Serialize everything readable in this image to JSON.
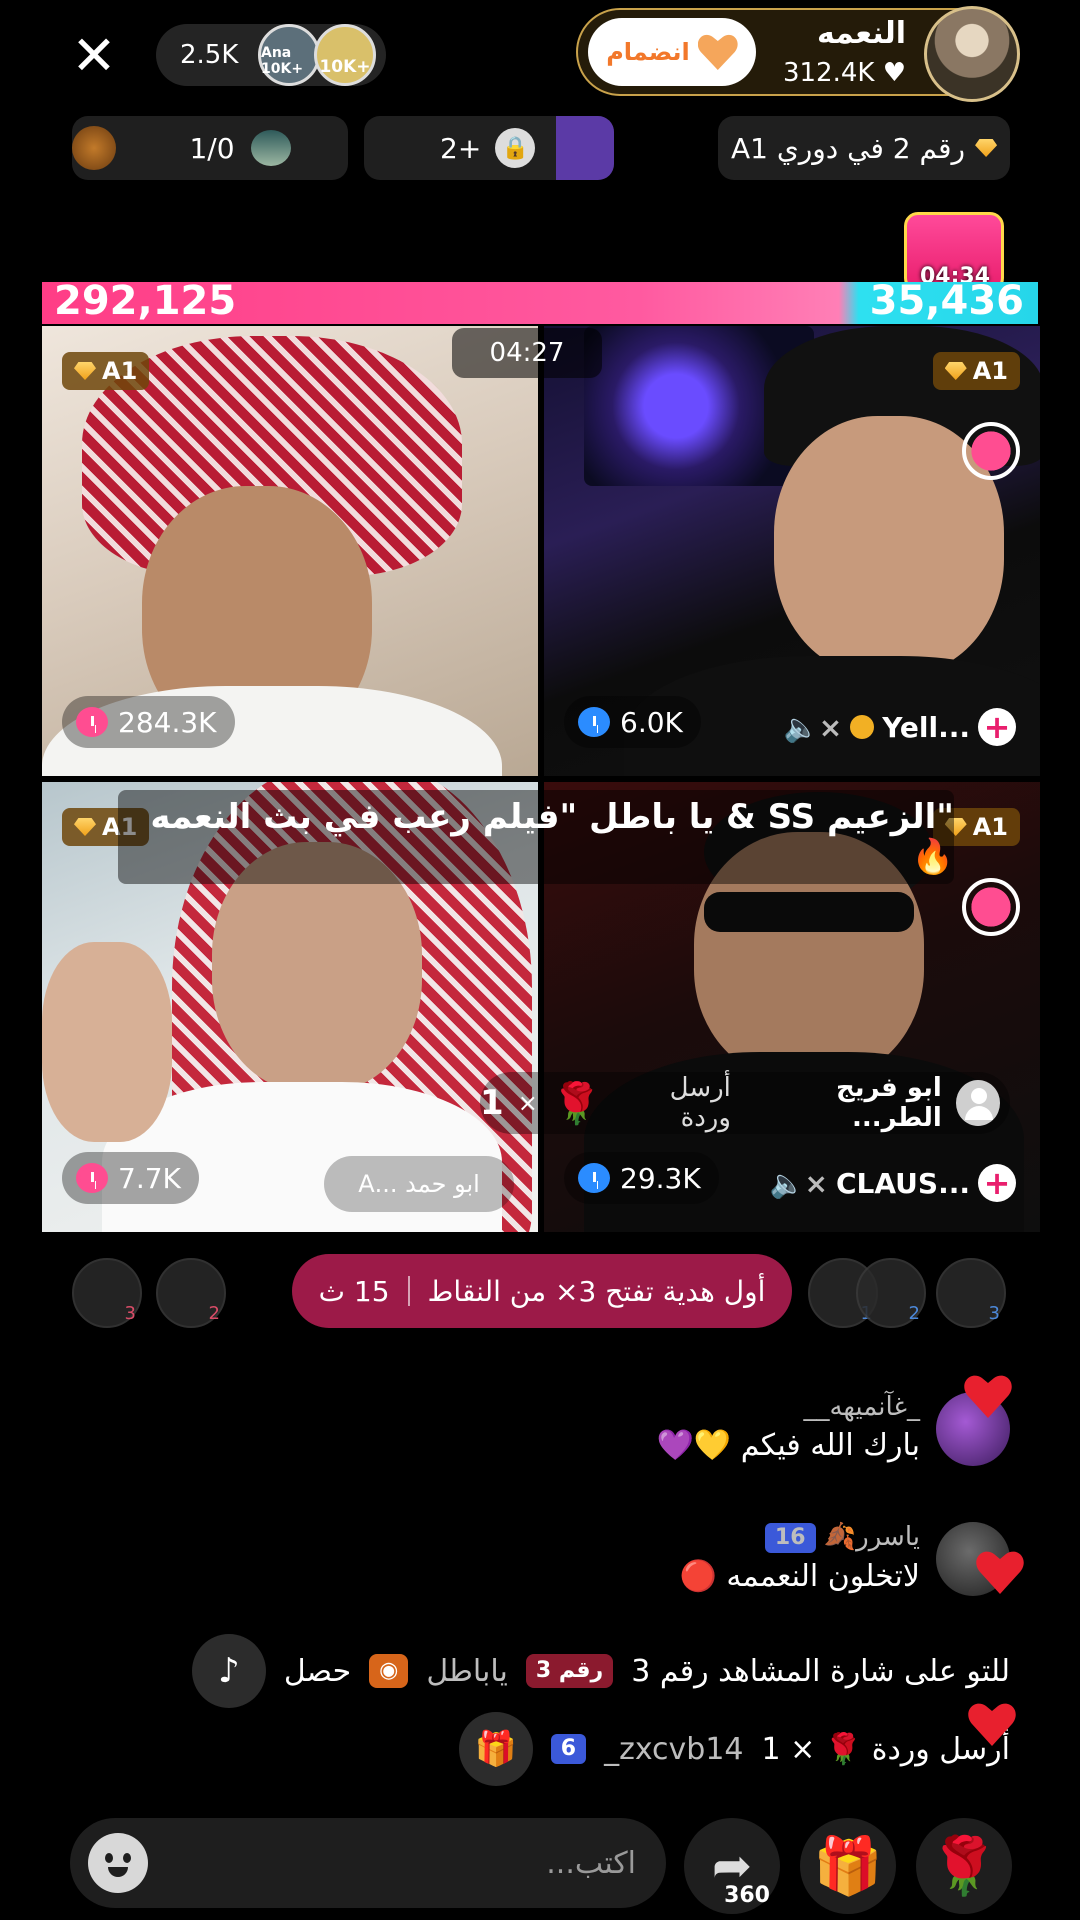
{
  "top": {
    "viewers": "2.5K",
    "viewer_badges": [
      "Ana 10K+",
      "10K+"
    ],
    "host_name": "النعمه",
    "host_likes": "312.4K",
    "join_label": "انضمام"
  },
  "status": {
    "league": "رقم 2 في دوري A1",
    "lock_count": "2+",
    "score": "1/0"
  },
  "treasure": {
    "time": "04:34"
  },
  "battle": {
    "score_left": "292,125",
    "score_right": "35,436",
    "timer": "04:27"
  },
  "tiles": [
    {
      "badge": "A1",
      "stat": "284.3K",
      "name": ""
    },
    {
      "badge": "A1",
      "stat": "6.0K",
      "name": "Yell..."
    },
    {
      "badge": "A1",
      "stat": "7.7K",
      "name": "ابو حمد ...A"
    },
    {
      "badge": "A1",
      "stat": "29.3K",
      "name": "CLAUS..."
    }
  ],
  "caption": "\"الزعيم SS & يا باطل \"فيلم رعب في بث النعمه🔥",
  "tile_gift": {
    "user": "ابو فريج الطر...",
    "action": "أرسل وردة",
    "count": "1",
    "times": "×"
  },
  "promo": {
    "text": "أول هدية تفتح 3× من النقاط",
    "time": "15 ث"
  },
  "slot_numbers": [
    "3",
    "2",
    "1",
    "2",
    "3"
  ],
  "chat": [
    {
      "user": "_غآنميهه__",
      "text": "بارك الله فيكم 💛💜"
    },
    {
      "user": "ياسرر🍂",
      "level": "16",
      "text": "لاتخلون النعممه 🔴"
    }
  ],
  "system": [
    {
      "pre": "حصل",
      "user": "ياباطل",
      "tag": "رقم 3",
      "post": "للتو على شارة المشاهد رقم 3"
    },
    {
      "level": "6",
      "user": "zxcvb14_",
      "text": "أرسل وردة 🌹 × 1"
    }
  ],
  "bottom": {
    "placeholder": "اكتب...",
    "share_count": "360"
  }
}
